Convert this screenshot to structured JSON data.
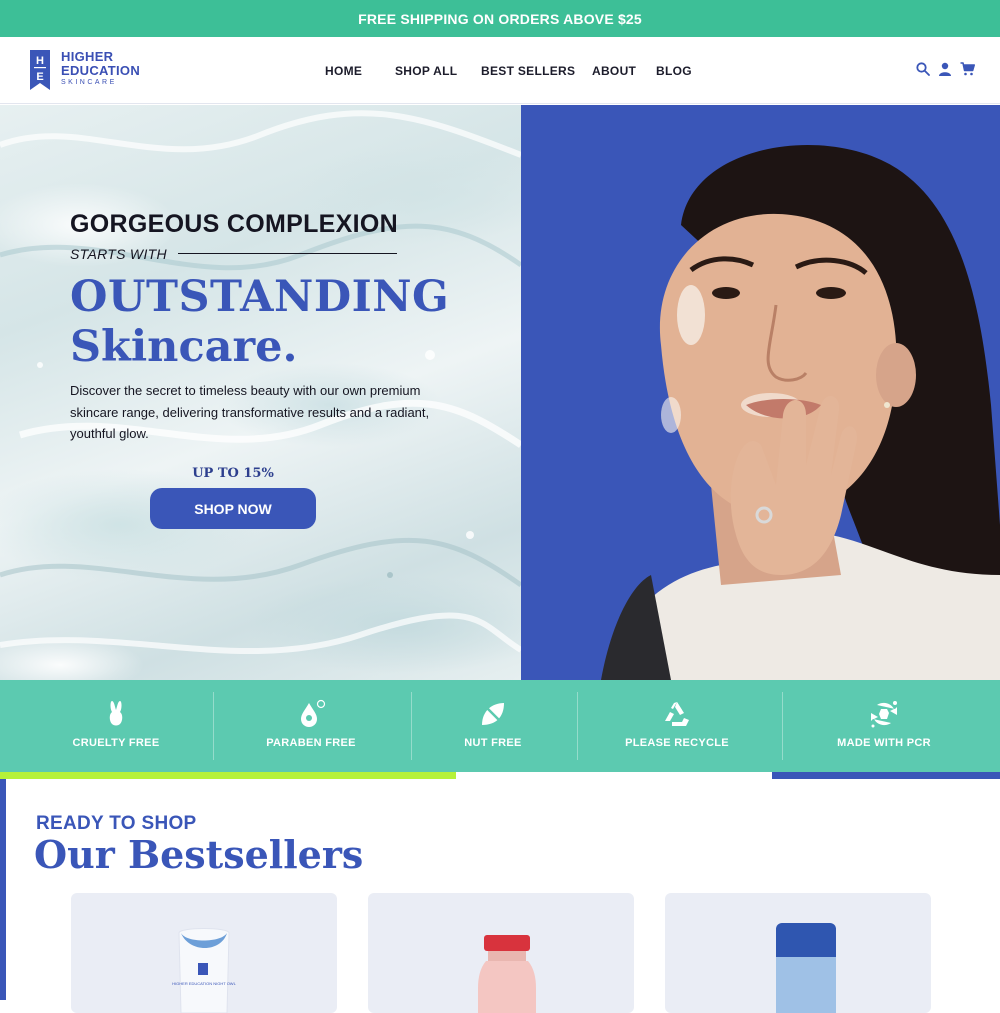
{
  "announcement": "FREE SHIPPING ON ORDERS ABOVE $25",
  "brand": {
    "line1": "HIGHER",
    "line2": "EDUCATION",
    "line3": "SKINCARE",
    "monogram": "HE",
    "color": "#3a56b8"
  },
  "nav": [
    "HOME",
    "SHOP ALL",
    "BEST SELLERS",
    "ABOUT",
    "BLOG"
  ],
  "header_icons": [
    "search-icon",
    "user-icon",
    "cart-icon"
  ],
  "hero": {
    "heading": "GORGEOUS COMPLEXION",
    "subheading": "STARTS WITH",
    "title_line1": "OUTSTANDING",
    "title_line2": "Skincare.",
    "description": "Discover the secret to timeless beauty with our own premium skincare range, delivering transformative results and a radiant, youthful glow.",
    "discount": "UP TO 15%",
    "cta": "SHOP NOW"
  },
  "features": [
    {
      "label": "CRUELTY FREE",
      "icon": "bunny-icon"
    },
    {
      "label": "PARABEN FREE",
      "icon": "drop-icon"
    },
    {
      "label": "NUT FREE",
      "icon": "leaf-icon"
    },
    {
      "label": "PLEASE RECYCLE",
      "icon": "recycle-icon"
    },
    {
      "label": "MADE WITH PCR",
      "icon": "pcr-icon"
    }
  ],
  "bestsellers": {
    "eyebrow": "READY TO SHOP",
    "title": "Our Bestsellers",
    "product1_label": "HIGHER EDUCATION NIGHT OWL"
  },
  "colors": {
    "teal": "#3dbf97",
    "mint": "#5ccab0",
    "blue": "#3a56b8",
    "lime": "#b6f23a"
  }
}
